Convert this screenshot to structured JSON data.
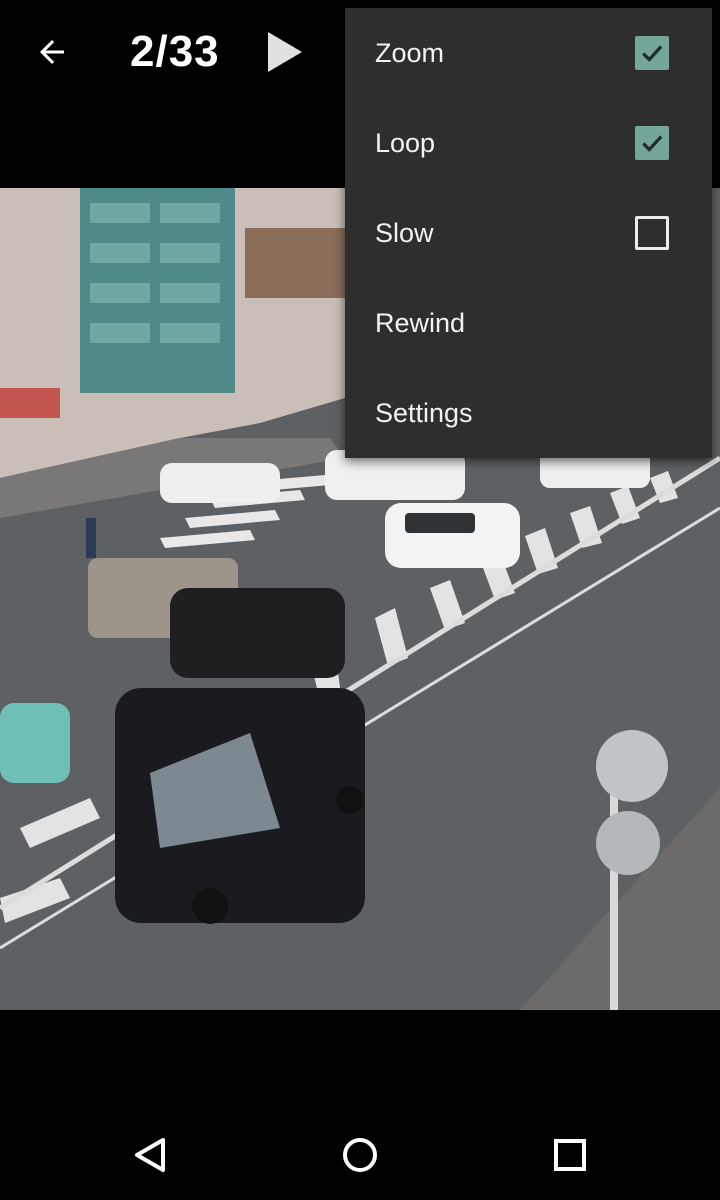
{
  "toolbar": {
    "counter": "2/33",
    "back_icon": "arrow-back-icon",
    "play_icon": "play-icon"
  },
  "photo": {
    "description_icon": "street-intersection-photo"
  },
  "menu": {
    "items": [
      {
        "label": "Zoom",
        "checkbox": true,
        "checked": true
      },
      {
        "label": "Loop",
        "checkbox": true,
        "checked": true
      },
      {
        "label": "Slow",
        "checkbox": true,
        "checked": false
      },
      {
        "label": "Rewind",
        "checkbox": false
      },
      {
        "label": "Settings",
        "checkbox": false
      }
    ]
  },
  "navbar": {
    "back_icon": "nav-back-icon",
    "home_icon": "nav-home-icon",
    "recents_icon": "nav-recents-icon"
  },
  "colors": {
    "checkbox_checked": "#74a69a",
    "menu_background": "#2e2e2e"
  }
}
